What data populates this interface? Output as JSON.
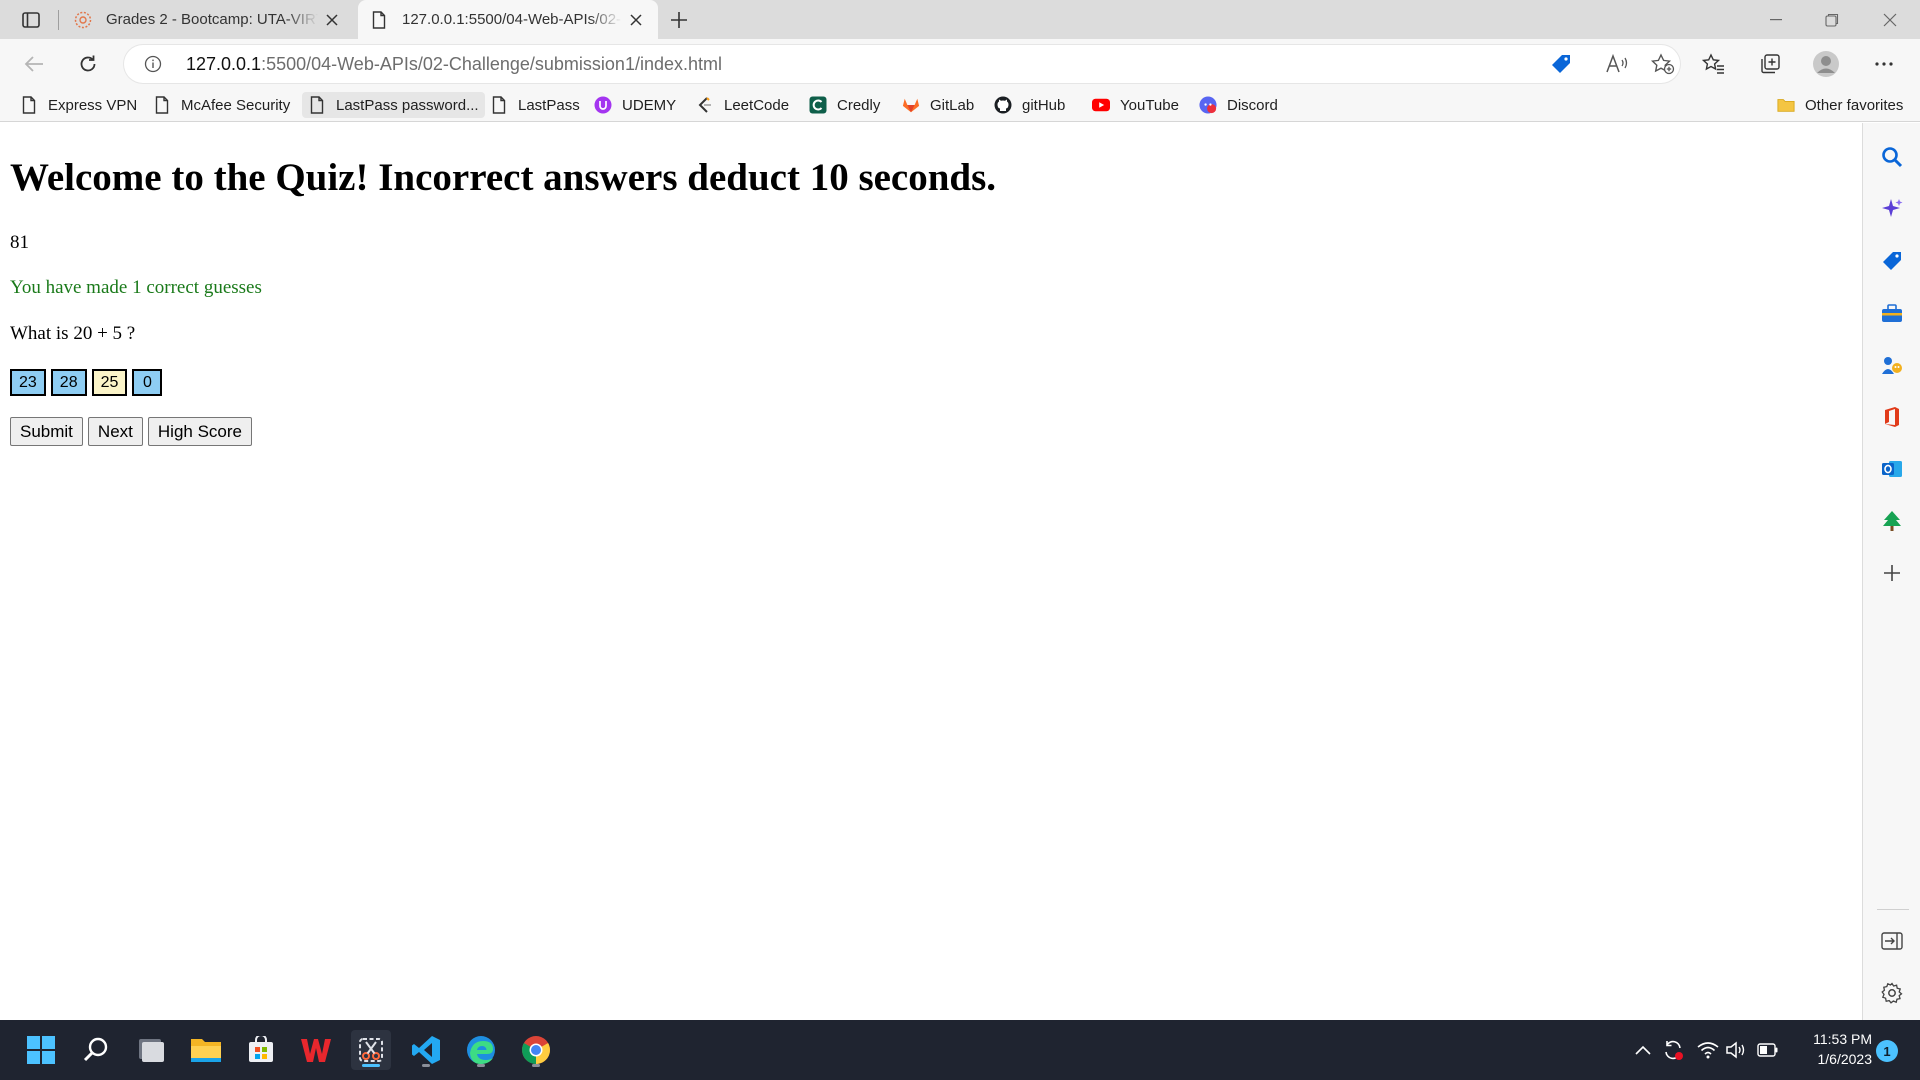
{
  "browser": {
    "tabs": [
      {
        "title": "Grades 2 - Bootcamp: UTA-VIRT-",
        "active": false
      },
      {
        "title": "127.0.0.1:5500/04-Web-APIs/02-",
        "active": true
      }
    ],
    "address": {
      "host": "127.0.0.1",
      "path": ":5500/04-Web-APIs/02-Challenge/submission1/index.html"
    },
    "favorites": [
      {
        "label": "Express VPN",
        "icon": "page-icon"
      },
      {
        "label": "McAfee Security",
        "icon": "page-icon"
      },
      {
        "label": "LastPass password...",
        "icon": "page-icon"
      },
      {
        "label": "LastPass",
        "icon": "page-icon"
      },
      {
        "label": "UDEMY",
        "icon": "udemy-icon"
      },
      {
        "label": "LeetCode",
        "icon": "leetcode-icon"
      },
      {
        "label": "Credly",
        "icon": "credly-icon"
      },
      {
        "label": "GitLab",
        "icon": "gitlab-icon"
      },
      {
        "label": "gitHub",
        "icon": "github-icon"
      },
      {
        "label": "YouTube",
        "icon": "youtube-icon"
      },
      {
        "label": "Discord",
        "icon": "discord-icon"
      }
    ],
    "other_favorites": "Other favorites"
  },
  "quiz": {
    "title": "Welcome to the Quiz! Incorrect answers deduct 10 seconds.",
    "timer": "81",
    "correct_message": "You have made 1 correct guesses",
    "question": "What is 20 + 5 ?",
    "choices": [
      "23",
      "28",
      "25",
      "0"
    ],
    "selected_choice": "25",
    "buttons": {
      "submit": "Submit",
      "next": "Next",
      "high_score": "High Score"
    }
  },
  "taskbar": {
    "time": "11:53 PM",
    "date": "1/6/2023",
    "notification_count": "1"
  },
  "colors": {
    "correct_text": "#1a7a1a",
    "choice_bg": "#8ecdf3",
    "selected_choice_bg": "#fbf4c8",
    "edge_accent": "#0a66d8"
  }
}
